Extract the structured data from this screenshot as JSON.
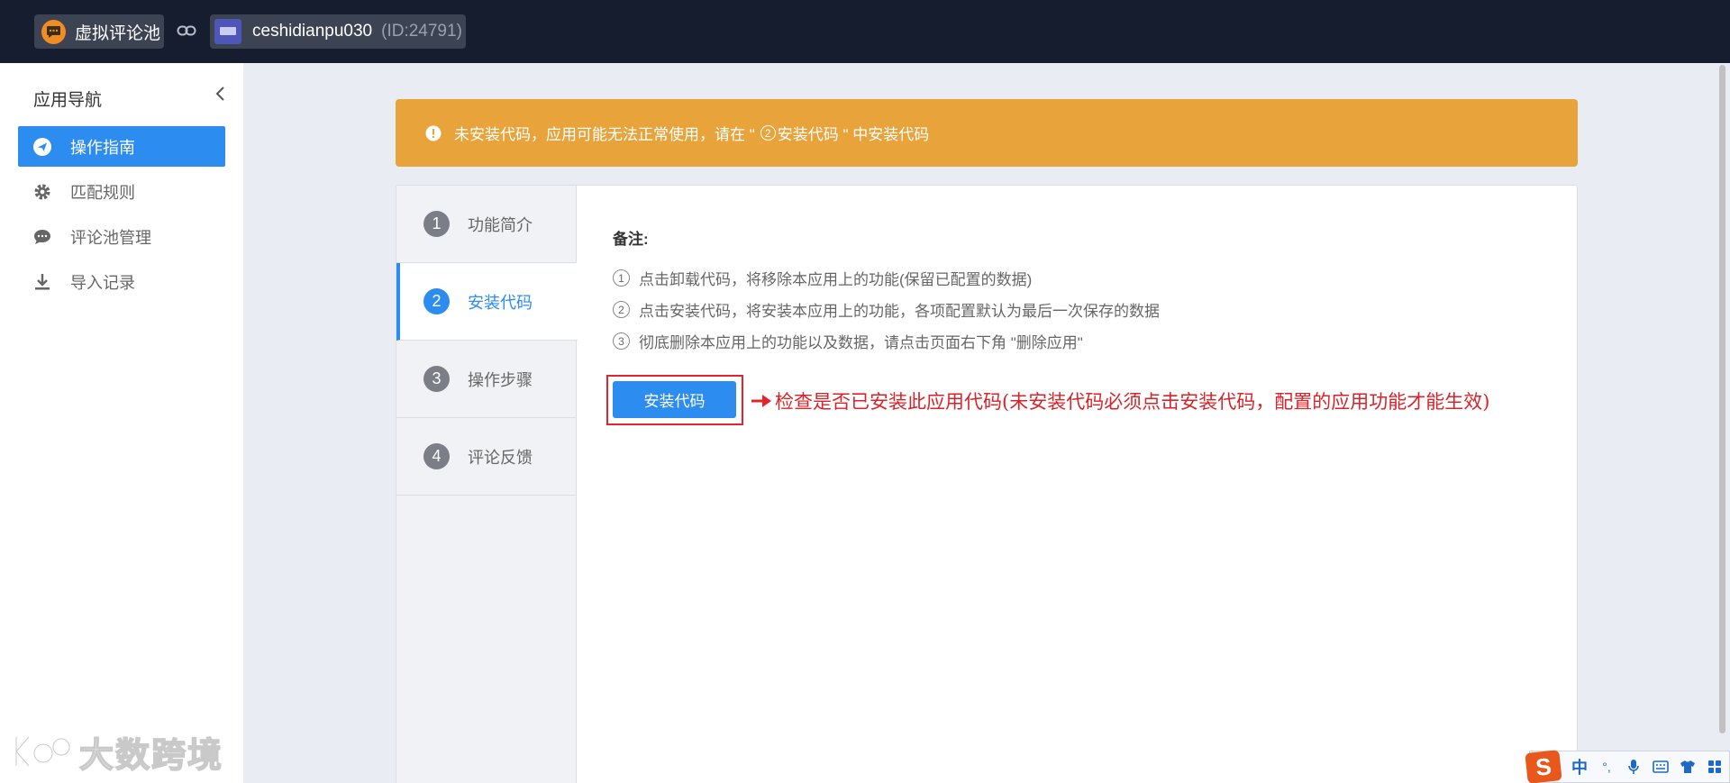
{
  "topbar": {
    "app_name": "虚拟评论池",
    "shop_name": "ceshidianpu030",
    "shop_id": "(ID:24791)"
  },
  "sidebar": {
    "title": "应用导航",
    "items": [
      {
        "label": "操作指南",
        "icon": "send-icon",
        "active": true
      },
      {
        "label": "匹配规则",
        "icon": "gear-icon",
        "active": false
      },
      {
        "label": "评论池管理",
        "icon": "comment-icon",
        "active": false
      },
      {
        "label": "导入记录",
        "icon": "download-icon",
        "active": false
      }
    ]
  },
  "alert": {
    "text_before": "未安装代码，应用可能无法正常使用，请在 \"",
    "circled_num": "2",
    "text_after": "安装代码 \" 中安装代码",
    "color": "#e8a33b"
  },
  "steps": [
    {
      "num": "1",
      "label": "功能简介"
    },
    {
      "num": "2",
      "label": "安装代码"
    },
    {
      "num": "3",
      "label": "操作步骤"
    },
    {
      "num": "4",
      "label": "评论反馈"
    }
  ],
  "content": {
    "notes_title": "备注:",
    "notes": [
      {
        "num": "1",
        "text": "点击卸载代码，将移除本应用上的功能(保留已配置的数据)"
      },
      {
        "num": "2",
        "text": "点击安装代码，将安装本应用上的功能，各项配置默认为最后一次保存的数据"
      },
      {
        "num": "3",
        "text": "彻底删除本应用上的功能以及数据，请点击页面右下角 \"删除应用\""
      }
    ],
    "install_button": "安装代码",
    "annotation": "检查是否已安装此应用代码(未安装代码必须点击安装代码，配置的应用功能才能生效)"
  },
  "watermark": {
    "text": "大数跨境"
  },
  "ime": {
    "logo": "S",
    "mode": "中",
    "punct": "°,"
  },
  "colors": {
    "primary": "#2d8cf0",
    "topbar": "#161d2e",
    "annotation_red": "#d9232a"
  }
}
